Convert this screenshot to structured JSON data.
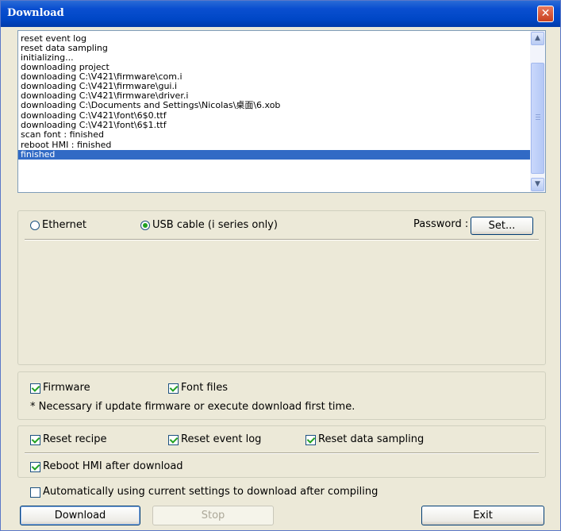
{
  "window": {
    "title": "Download",
    "close_label": "✕"
  },
  "log": {
    "lines": [
      "reset event log",
      "reset data sampling",
      "initializing...",
      "downloading project",
      "downloading C:\\V421\\firmware\\com.i",
      "downloading C:\\V421\\firmware\\gui.i",
      "downloading C:\\V421\\firmware\\driver.i",
      "downloading C:\\Documents and Settings\\Nicolas\\桌面\\6.xob",
      "downloading C:\\V421\\font\\6$0.ttf",
      "downloading C:\\V421\\font\\6$1.ttf",
      "scan font : finished",
      "reboot HMI : finished"
    ],
    "selected_line": "finished"
  },
  "connection": {
    "ethernet_label": "Ethernet",
    "usb_label": "USB cable (i series only)",
    "selected": "usb",
    "password_label": "Password :",
    "set_button": "Set..."
  },
  "files": {
    "firmware_label": "Firmware",
    "firmware_checked": true,
    "font_label": "Font files",
    "font_checked": true,
    "note": "* Necessary if update firmware or execute download first time."
  },
  "reset": {
    "recipe_label": "Reset recipe",
    "recipe_checked": true,
    "event_log_label": "Reset event log",
    "event_log_checked": true,
    "data_sampling_label": "Reset data sampling",
    "data_sampling_checked": true,
    "reboot_label": "Reboot HMI after download",
    "reboot_checked": true
  },
  "auto_download": {
    "label": "Automatically using current settings to download after compiling",
    "checked": false
  },
  "buttons": {
    "download": "Download",
    "stop": "Stop",
    "exit": "Exit"
  }
}
